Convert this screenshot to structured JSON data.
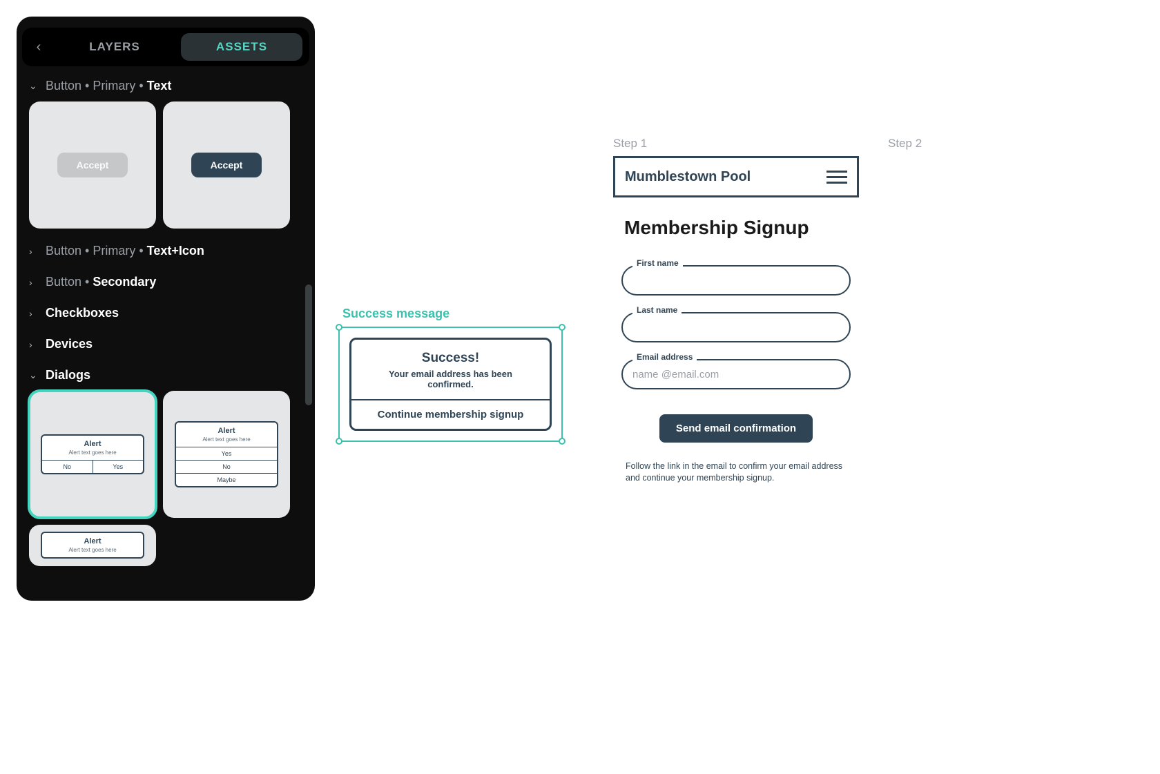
{
  "panel": {
    "tabs": {
      "layers": "LAYERS",
      "assets": "ASSETS"
    },
    "tree": {
      "button_primary_text": {
        "prefix": "Button • Primary • ",
        "bold": "Text"
      },
      "button_primary_ticon": {
        "prefix": "Button • Primary • ",
        "bold": "Text+Icon"
      },
      "button_secondary": {
        "prefix": "Button • ",
        "bold": "Secondary"
      },
      "checkboxes": {
        "bold": "Checkboxes"
      },
      "devices": {
        "bold": "Devices"
      },
      "dialogs": {
        "bold": "Dialogs"
      }
    },
    "button_thumbs": {
      "label": "Accept"
    },
    "dialog_thumbs": {
      "a": {
        "title": "Alert",
        "sub": "Alert text goes here",
        "no": "No",
        "yes": "Yes"
      },
      "b": {
        "title": "Alert",
        "sub": "Alert text goes here",
        "o1": "Yes",
        "o2": "No",
        "o3": "Maybe"
      },
      "c": {
        "title": "Alert",
        "sub": "Alert text goes here"
      }
    }
  },
  "canvas": {
    "success": {
      "caption": "Success message",
      "title": "Success!",
      "body": "Your email address has been confirmed.",
      "action": "Continue membership signup"
    }
  },
  "signup": {
    "step1": "Step 1",
    "step2": "Step 2",
    "site_title": "Mumblestown Pool",
    "heading": "Membership Signup",
    "fields": {
      "first_name": "First name",
      "last_name": "Last name",
      "email": "Email address",
      "email_ph": "name @email.com"
    },
    "send_button": "Send email confirmation",
    "helper": "Follow the link in the email to confirm your email address and continue your membership signup."
  }
}
